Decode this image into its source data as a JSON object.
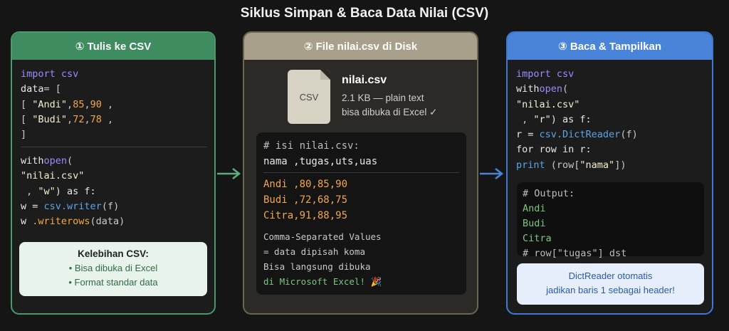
{
  "title": "Siklus Simpan & Baca Data Nilai (CSV)",
  "colors": {
    "green": "#3e8c5f",
    "tan": "#a8a08a",
    "blue": "#4a84d8",
    "orange": "#f4a64a"
  },
  "panel1": {
    "header": "① Tulis ke CSV",
    "code": {
      "l1_kw": "import",
      "l1_mod": "csv",
      "l2": "data",
      "l2b": "= [",
      "l3a": "[ ",
      "l3s": "\"Andi\"",
      "l3n": "85",
      "l3c": ",",
      "l3n2": "90",
      "l3e": " ,",
      "l4a": "[ ",
      "l4s": "\"Budi\"",
      "l4n": "72",
      "l4c": ",",
      "l4n2": "78",
      "l4e": " ,",
      "l5": "]",
      "l6_kw": "with",
      "l6_fn": "open",
      "l6b": "(",
      "l7": "\"nilai.csv\"",
      "l8a": " , ",
      "l8s": "\"w\"",
      "l8b": ") as f:",
      "l9a": "w = ",
      "l9b": "csv",
      "l9c": ".writer",
      "l9d": "(f)",
      "l10a": "w ",
      "l10b": ".writerows",
      "l10c": "(data)"
    },
    "note": {
      "title": "Kelebihan CSV:",
      "items": [
        "• Bisa dibuka di Excel",
        "• Format standar data"
      ]
    }
  },
  "panel2": {
    "header": "② File nilai.csv di Disk",
    "file_icon_label": "CSV",
    "file_name": "nilai.csv",
    "file_size": "2.1 KB — plain text",
    "file_note": "bisa dibuka di Excel ✓",
    "csv_comment": "# isi nilai.csv:",
    "csv_header": "nama ,tugas,uts,uas",
    "rows": [
      "Andi ,80,85,90",
      "Budi ,72,68,75",
      "Citra,91,88,95"
    ],
    "footer_lines": [
      "Comma-Separated Values",
      "= data dipisah koma",
      "Bisa langsung dibuka"
    ],
    "footer_green": "di Microsoft Excel! 🎉"
  },
  "panel3": {
    "header": "③ Baca & Tampilkan",
    "code": {
      "l1_kw": "import",
      "l1_mod": "csv",
      "l2_kw": "with",
      "l2_fn": "open",
      "l2b": "(",
      "l3": "\"nilai.csv\"",
      "l4a": " , ",
      "l4s": "\"r\"",
      "l4b": ") as f:",
      "l5a": "r = ",
      "l5b": "csv",
      "l5c": ".DictReader",
      "l5d": "(f)",
      "l6_kw": "for",
      "l6b": " row ",
      "l6_kw2": "in",
      "l6c": " r:",
      "l7_fn": "print",
      "l7a": " (row[",
      "l7s": "\"nama\"",
      "l7b": "])"
    },
    "output_comment": "# Output:",
    "output": [
      "Andi",
      "Budi",
      "Citra"
    ],
    "output_tail": "# row[\"tugas\"] dst",
    "note": [
      "DictReader otomatis",
      "jadikan baris 1 sebagai header!"
    ]
  }
}
